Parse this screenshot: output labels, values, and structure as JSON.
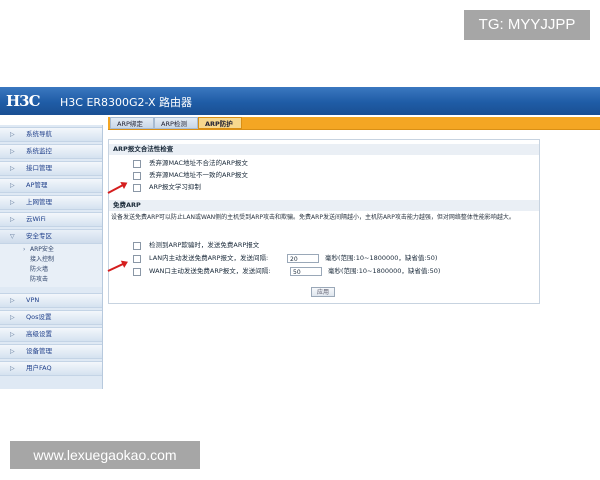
{
  "watermarks": {
    "top": "TG: MYYJJPP",
    "bottom": "www.lexuegaokao.com"
  },
  "header": {
    "logo": "H3C",
    "title": "H3C ER8300G2-X 路由器"
  },
  "sidebar": {
    "items": [
      {
        "label": "系统导航"
      },
      {
        "label": "系统监控"
      },
      {
        "label": "接口管理"
      },
      {
        "label": "AP管理"
      },
      {
        "label": "上网管理"
      },
      {
        "label": "云WiFi"
      },
      {
        "label": "安全专区"
      },
      {
        "label": "VPN"
      },
      {
        "label": "Qos设置"
      },
      {
        "label": "高级设置"
      },
      {
        "label": "设备管理"
      },
      {
        "label": "用户FAQ"
      }
    ],
    "security_sub": [
      "ARP安全",
      "接入控制",
      "防火墙",
      "防攻击"
    ]
  },
  "tabs": [
    "ARP绑定",
    "ARP检测",
    "ARP防护"
  ],
  "legality": {
    "title": "ARP报文合法性检查",
    "options": [
      "丢弃源MAC地址不合法的ARP报文",
      "丢弃源MAC地址不一致的ARP报文",
      "ARP报文学习抑制"
    ]
  },
  "free_arp": {
    "title": "免费ARP",
    "description": "设备发送免费ARP可以防止LAN或WAN侧的主机受到ARP攻击和欺骗。免费ARP发送间隔越小，主机防ARP攻击能力越强，但对网络整体性能影响越大。",
    "detect_label": "检测到ARP欺骗时，发送免费ARP报文",
    "lan_label": "LAN内主动发送免费ARP报文，发送间隔:",
    "lan_value": "20",
    "lan_hint": "毫秒(范围:10~1800000，缺省值:50)",
    "wan_label": "WAN口主动发送免费ARP报文，发送间隔:",
    "wan_value": "50",
    "wan_hint": "毫秒(范围:10~1800000，缺省值:50)"
  },
  "apply_label": "应用",
  "colors": {
    "header": "#1f5ca6",
    "tab_bar": "#f4a623",
    "annotation_arrow": "#d51e1e"
  }
}
